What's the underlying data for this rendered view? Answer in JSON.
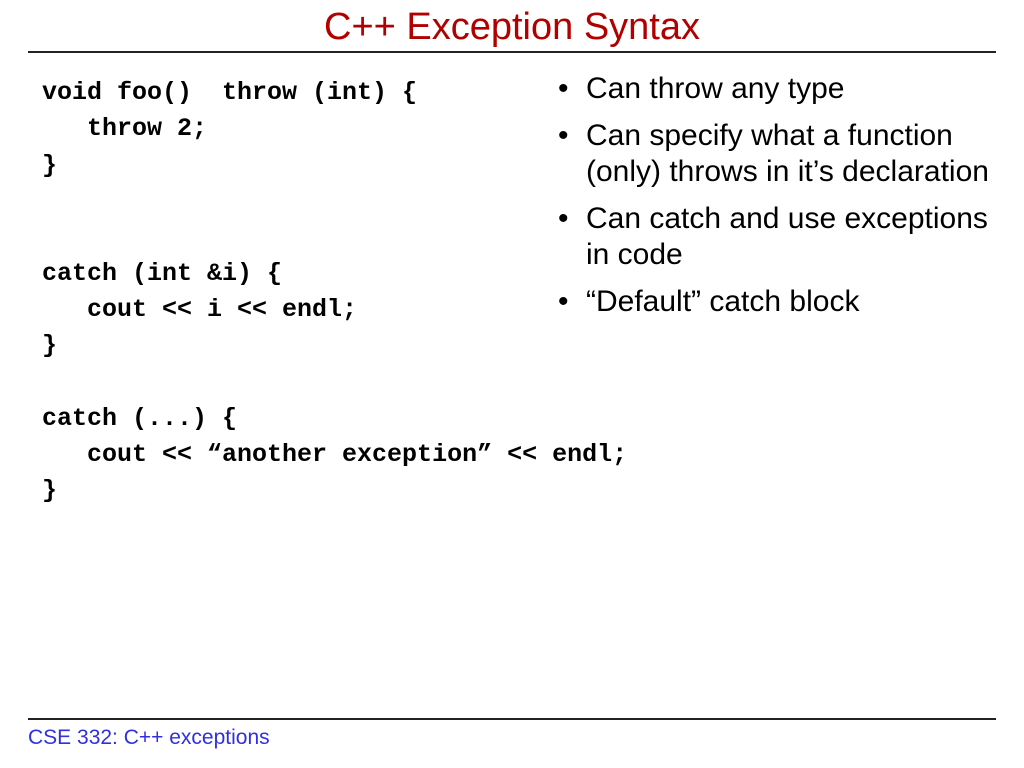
{
  "title": "C++ Exception Syntax",
  "code": {
    "l1": "void foo()  throw (int) {",
    "l2": "   throw 2;",
    "l3": "}",
    "l4": "catch (int &i) {",
    "l5": "   cout << i << endl;",
    "l6": "}",
    "l7": "catch (...) {",
    "l8": "   cout << “another exception” << endl;",
    "l9": "}"
  },
  "bullets": {
    "b1": "Can throw any type",
    "b2": "Can specify what a function (only) throws in it’s declaration",
    "b3": "Can catch and use exceptions in code",
    "b4": "“Default” catch block"
  },
  "footer": "CSE 332: C++ exceptions"
}
